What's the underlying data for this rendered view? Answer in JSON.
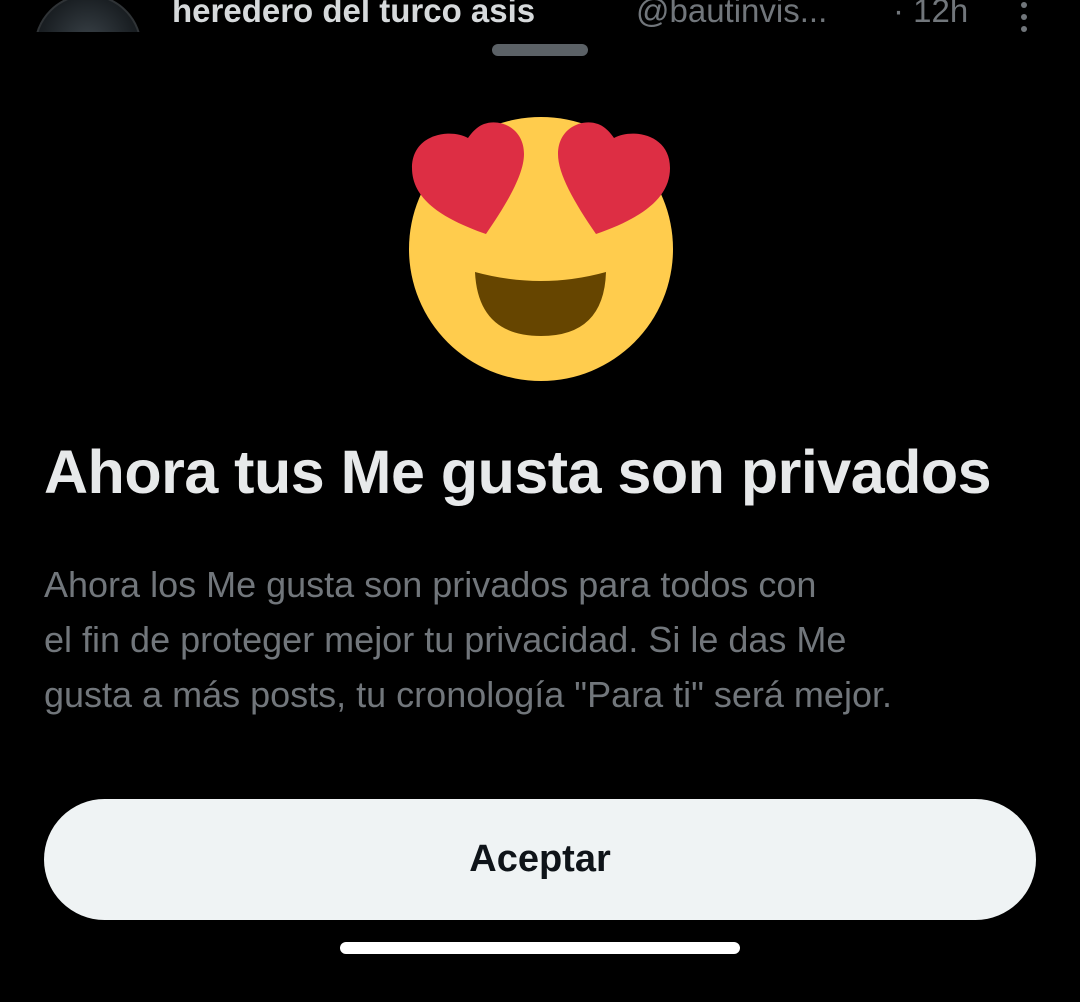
{
  "background_tweet": {
    "author_name": "heredero del turco asis",
    "handle": "@bautinvis...",
    "time": "· 12h",
    "avatar_icon": "user-avatar",
    "more_icon": "more-vertical-icon"
  },
  "sheet": {
    "emoji_icon": "smiling-face-with-heart-eyes-icon",
    "title": "Ahora tus Me gusta son privados",
    "body_lines": [
      "Ahora los Me gusta son privados para todos con",
      "el fin de proteger mejor tu privacidad. Si le das Me",
      "gusta a más posts, tu cronología \"Para ti\" será mejor."
    ],
    "accept_label": "Aceptar"
  },
  "colors": {
    "background": "#000000",
    "title": "#e7e9ea",
    "body": "#71767b",
    "button_bg": "#eff3f4",
    "button_text": "#0f1419",
    "emoji_face": "#ffcc4d",
    "emoji_hearts": "#dd2e44",
    "emoji_mouth": "#664500"
  }
}
